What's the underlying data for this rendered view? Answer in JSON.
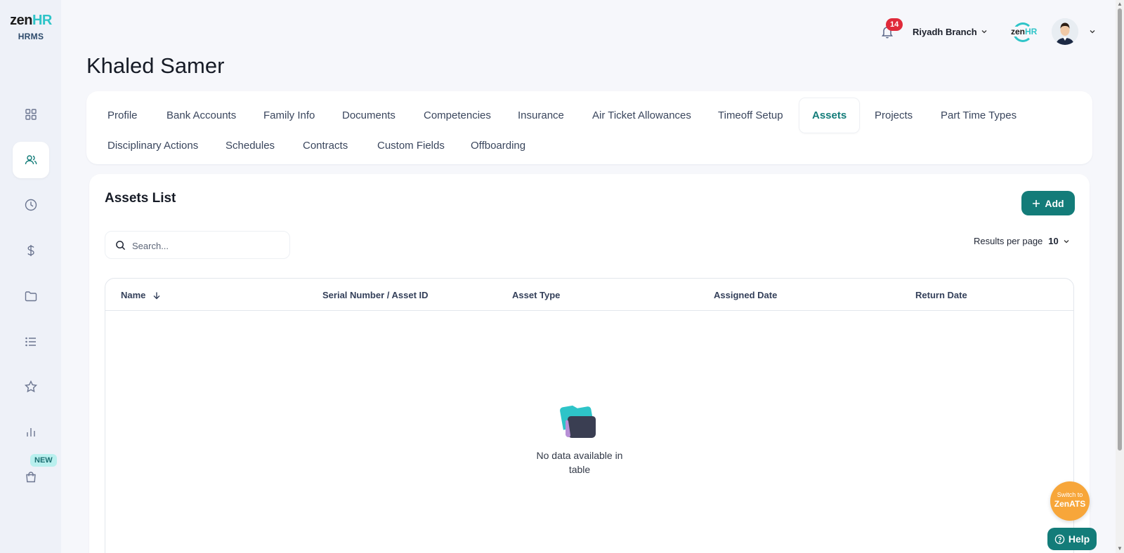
{
  "app": {
    "logo_main": "zen",
    "logo_accent": "HR",
    "logo_sub": "HRMS",
    "new_badge": "NEW"
  },
  "sidebar": {
    "items": [
      {
        "name": "dashboard",
        "icon": "grid-icon"
      },
      {
        "name": "employees",
        "icon": "users-icon",
        "active": true
      },
      {
        "name": "time",
        "icon": "clock-icon"
      },
      {
        "name": "payroll",
        "icon": "dollar-icon"
      },
      {
        "name": "documents",
        "icon": "folder-icon"
      },
      {
        "name": "lists",
        "icon": "list-icon"
      },
      {
        "name": "performance",
        "icon": "star-icon"
      },
      {
        "name": "reports",
        "icon": "bar-chart-icon"
      },
      {
        "name": "shop",
        "icon": "bag-icon"
      }
    ]
  },
  "header": {
    "notifications_count": "14",
    "branch": "Riyadh Branch",
    "mini_logo_main": "zen",
    "mini_logo_accent": "HR"
  },
  "page": {
    "title": "Khaled Samer"
  },
  "tabs": {
    "items": [
      {
        "label": "Profile"
      },
      {
        "label": "Bank Accounts"
      },
      {
        "label": "Family Info"
      },
      {
        "label": "Documents"
      },
      {
        "label": "Competencies"
      },
      {
        "label": "Insurance"
      },
      {
        "label": "Air Ticket Allowances"
      },
      {
        "label": "Timeoff Setup"
      },
      {
        "label": "Assets",
        "active": true
      },
      {
        "label": "Projects"
      },
      {
        "label": "Part Time Types"
      },
      {
        "label": "Disciplinary Actions"
      },
      {
        "label": "Schedules"
      },
      {
        "label": "Contracts"
      },
      {
        "label": "Custom Fields"
      },
      {
        "label": "Offboarding"
      }
    ]
  },
  "assets": {
    "title": "Assets List",
    "add_label": "Add",
    "search_placeholder": "Search...",
    "rpp_label": "Results per page",
    "rpp_value": "10",
    "columns": [
      "Name",
      "Serial Number / Asset ID",
      "Asset Type",
      "Assigned Date",
      "Return Date"
    ],
    "empty_text": "No data available in table"
  },
  "floating": {
    "switch_line1": "Switch to",
    "switch_line2": "ZenATS",
    "help_label": "Help"
  },
  "colors": {
    "accent": "#137c79",
    "brand_cyan": "#2ec4c8",
    "badge_red": "#e02a3a",
    "switch_orange": "#f7a63a"
  }
}
